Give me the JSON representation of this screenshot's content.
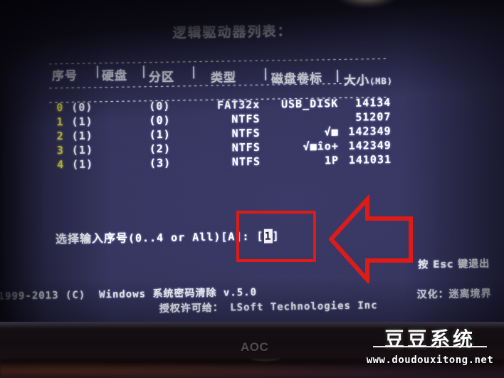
{
  "screen": {
    "title": "逻辑驱动器列表：",
    "rule": "-------------------------------------------------------------",
    "table": {
      "headers": {
        "index": "序号",
        "disk": "硬盘",
        "partition": "分区",
        "type": "类型",
        "volume": "磁盘卷标",
        "size": "大小",
        "size_unit": "(MB)",
        "separator": "|"
      },
      "rows": [
        {
          "index": "0",
          "disk": "(0)",
          "partition": "(0)",
          "type": "FAT32x",
          "volume": "USB_DISK",
          "size": "14134"
        },
        {
          "index": "1",
          "disk": "(1)",
          "partition": "(0)",
          "type": "NTFS",
          "volume": "",
          "size": "51207"
        },
        {
          "index": "2",
          "disk": "(1)",
          "partition": "(1)",
          "type": "NTFS",
          "volume": "√■",
          "size": "142349"
        },
        {
          "index": "3",
          "disk": "(1)",
          "partition": "(2)",
          "type": "NTFS",
          "volume": "√■îo+",
          "size": "142349"
        },
        {
          "index": "4",
          "disk": "(1)",
          "partition": "(3)",
          "type": "NTFS",
          "volume": "1P",
          "size": "141031"
        }
      ]
    },
    "prompt": {
      "label": "选择输入序号",
      "range": "(0..4 or All)[A]:",
      "open_bracket": "[",
      "value": "1",
      "close_bracket": "]"
    },
    "esc_hint": "按 Esc 键退出",
    "copyright_line1": "1999-2013 (C)  Windows 系统密码清除 v.5.0",
    "copyright_line2": "授权许可给： LSoft Technologies Inc",
    "translator": "汉化：迷离境界"
  },
  "annotations": {
    "highlight_color": "#e01b16",
    "box_label": "input-field-highlight",
    "arrow_label": "pointer-arrow"
  },
  "monitor": {
    "brand": "AOC"
  },
  "watermark": {
    "title": "豆豆系统",
    "url": "www.doudouxitong.net"
  }
}
